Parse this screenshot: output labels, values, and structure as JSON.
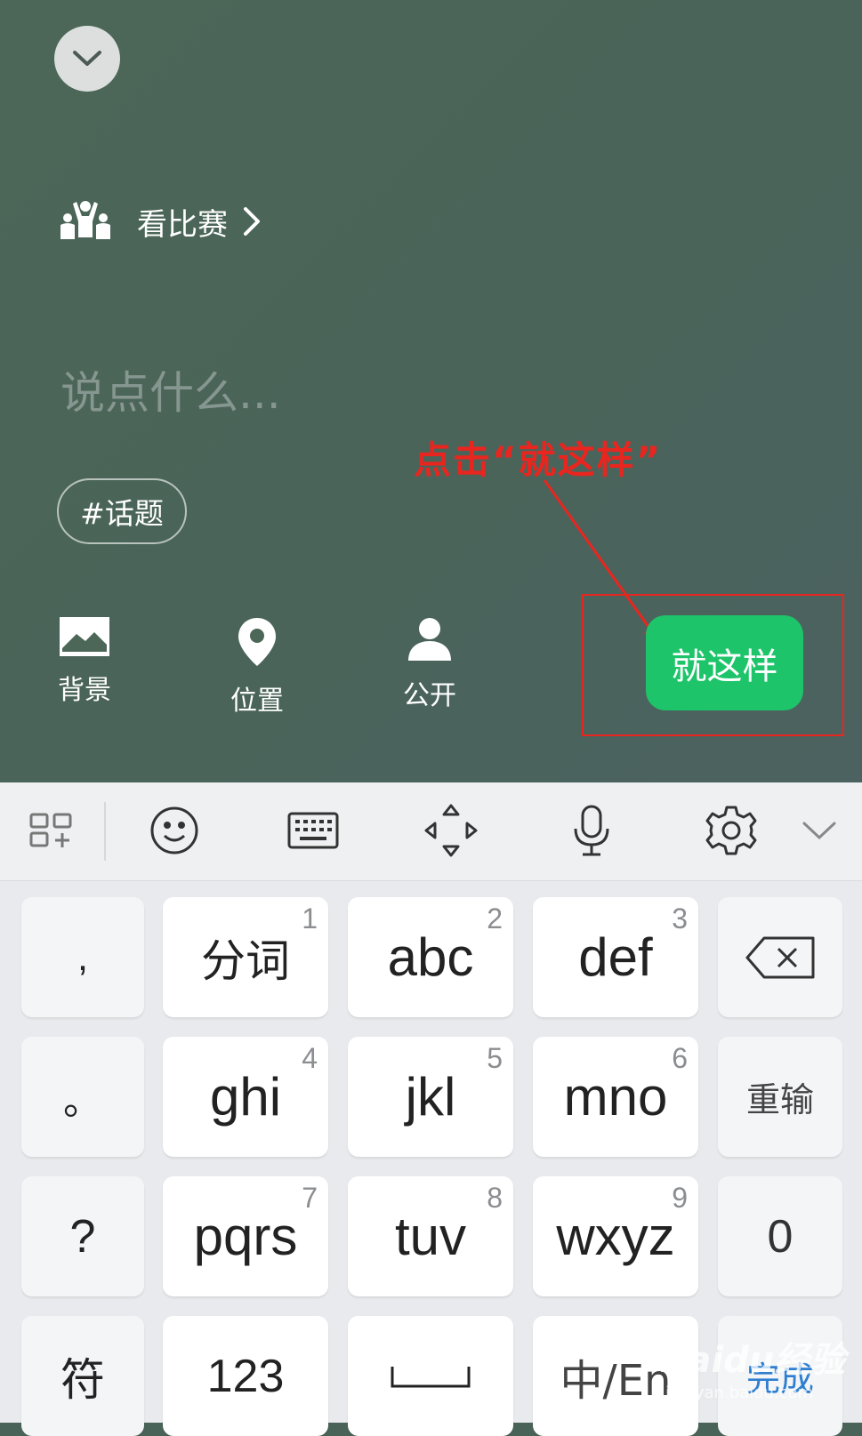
{
  "header": {
    "activity_label": "看比赛"
  },
  "compose": {
    "placeholder": "说点什么..."
  },
  "topic": {
    "label": "#话题"
  },
  "annotation": {
    "text": "点击“就这样”",
    "color": "#e8261f"
  },
  "toolbar": {
    "background_label": "背景",
    "location_label": "位置",
    "visibility_label": "公开",
    "done_label": "就这样",
    "done_color": "#1ec46a"
  },
  "keyboard": {
    "toolbar_icons": [
      "layout-icon",
      "emoji-icon",
      "keyboard-icon",
      "cursor-move-icon",
      "microphone-icon",
      "settings-icon",
      "hide-keyboard-icon"
    ],
    "side_left": [
      ",",
      "。",
      "?",
      "符"
    ],
    "keys": [
      {
        "label": "分词",
        "num": "1"
      },
      {
        "label": "abc",
        "num": "2"
      },
      {
        "label": "def",
        "num": "3"
      },
      {
        "label": "ghi",
        "num": "4"
      },
      {
        "label": "jkl",
        "num": "5"
      },
      {
        "label": "mno",
        "num": "6"
      },
      {
        "label": "pqrs",
        "num": "7"
      },
      {
        "label": "tuv",
        "num": "8"
      },
      {
        "label": "wxyz",
        "num": "9"
      }
    ],
    "side_right": {
      "reinput": "重输",
      "zero": "0",
      "done": "完成"
    },
    "bottom": {
      "num_key": "123",
      "lang_key": "中/En"
    }
  },
  "watermark": {
    "text": "Baidu经验",
    "sub": "jingyan.baidu.com"
  }
}
